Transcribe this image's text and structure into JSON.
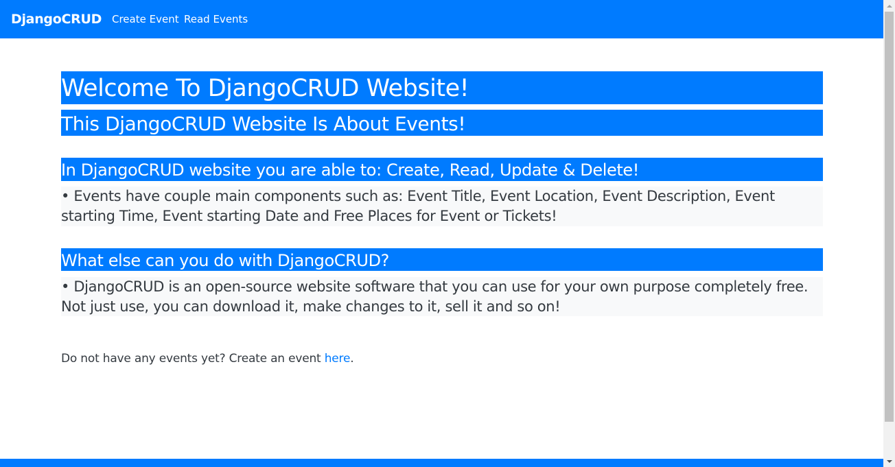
{
  "navbar": {
    "brand": "DjangoCRUD",
    "links": [
      {
        "label": "Create Event"
      },
      {
        "label": "Read Events"
      }
    ]
  },
  "main": {
    "heading1": "Welcome To DjangoCRUD Website!",
    "heading2": "This DjangoCRUD Website Is About Events!",
    "section1": {
      "heading": "In DjangoCRUD website you are able to: Create, Read, Update & Delete!",
      "text": "• Events have couple main components such as: Event Title, Event Location, Event Description, Event starting Time, Event starting Date and Free Places for Event or Tickets!"
    },
    "section2": {
      "heading": "What else can you do with DjangoCRUD?",
      "text": "• DjangoCRUD is an open-source website software that you can use for your own purpose completely free. Not just use, you can download it, make changes to it, sell it and so on!"
    },
    "cta": {
      "prefix": "Do not have any events yet? Create an event ",
      "link": "here",
      "suffix": "."
    }
  },
  "colors": {
    "primary": "#007bff",
    "paragraph_bg": "#f8f9fa",
    "text": "#343a40"
  },
  "icons": {
    "scroll_up": "chevron-up-icon",
    "scroll_down": "chevron-down-icon"
  }
}
